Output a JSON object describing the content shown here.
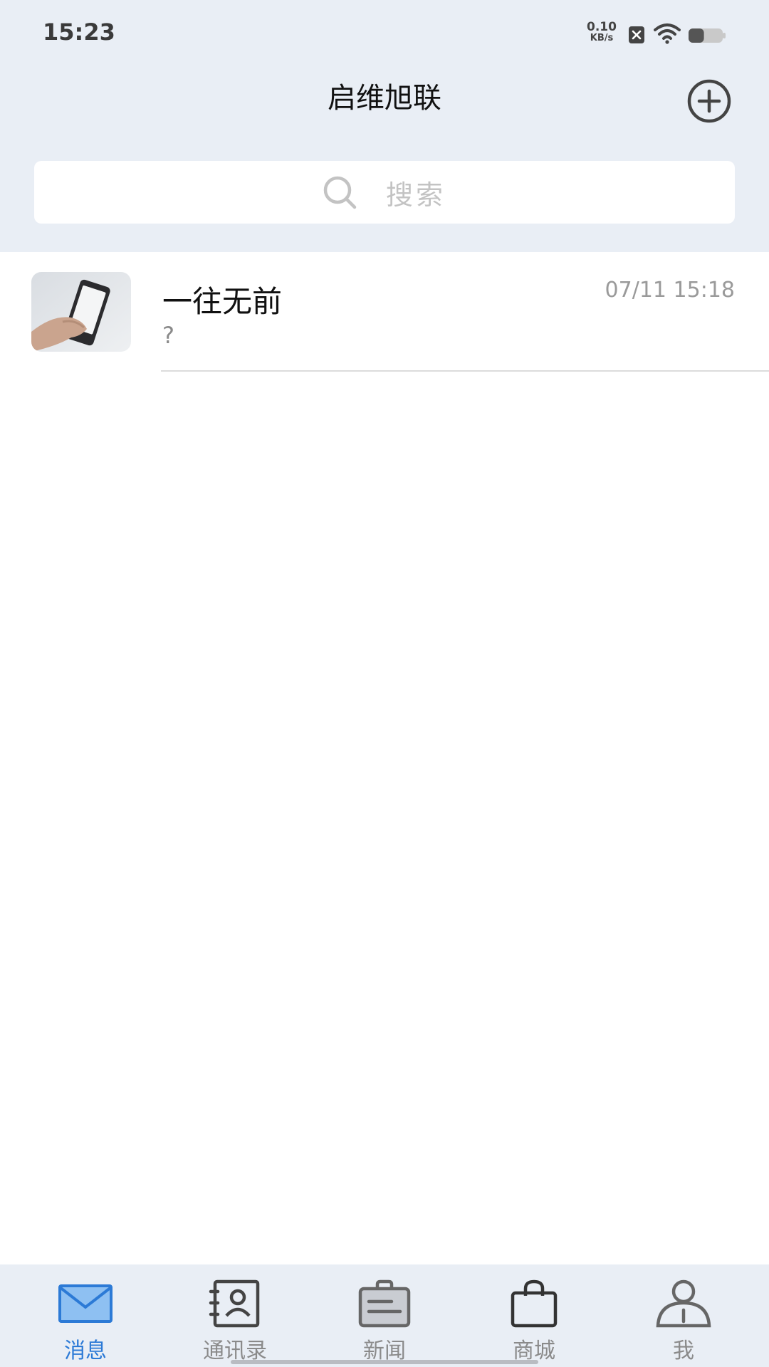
{
  "status_bar": {
    "time": "15:23",
    "net_speed_value": "0.10",
    "net_speed_unit": "KB/s",
    "icons": [
      "sim-off-icon",
      "wifi-icon",
      "battery-icon"
    ],
    "battery_level": 0.45
  },
  "header": {
    "title": "启维旭联",
    "add_icon": "plus-circle-icon"
  },
  "search": {
    "placeholder": "搜索",
    "icon": "search-icon"
  },
  "conversations": [
    {
      "name": "一往无前",
      "time": "07/11 15:18",
      "preview": "?",
      "avatar": "phone-in-hand-photo"
    }
  ],
  "tabs": [
    {
      "label": "消息",
      "icon": "envelope-icon",
      "active": true
    },
    {
      "label": "通讯录",
      "icon": "contacts-book-icon",
      "active": false
    },
    {
      "label": "新闻",
      "icon": "news-briefcase-icon",
      "active": false
    },
    {
      "label": "商城",
      "icon": "shopping-bag-icon",
      "active": false
    },
    {
      "label": "我",
      "icon": "person-icon",
      "active": false
    }
  ],
  "colors": {
    "header_bg": "#e9eef5",
    "accent": "#2c7ad6",
    "tab_inactive": "#8a8a8a"
  }
}
